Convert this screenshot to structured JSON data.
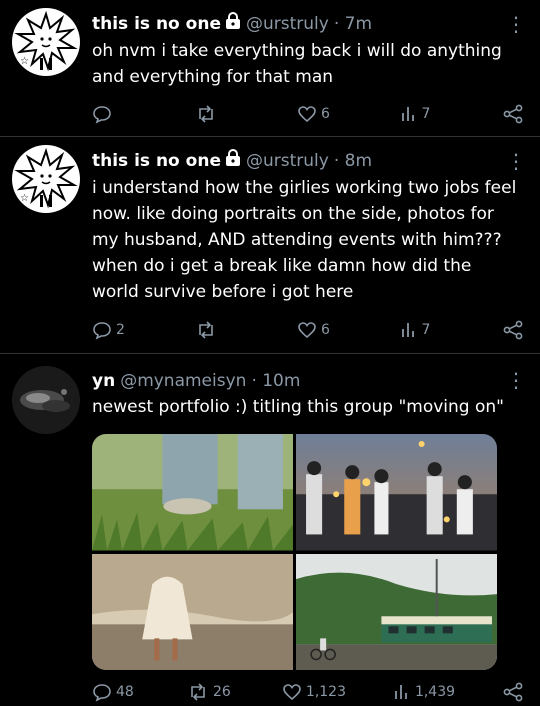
{
  "tweets": [
    {
      "name": "this is no one",
      "handle": "@urstruly",
      "time": "· 7m",
      "text": "oh nvm i take everything back i will do anything and everything for that man",
      "reply_count": "",
      "retweet_count": "",
      "like_count": "6",
      "view_count": "7"
    },
    {
      "name": "this is no one",
      "handle": "@urstruly",
      "time": "· 8m",
      "text": "i understand how the girlies working two jobs feel now. like doing portraits on the side, photos for my husband, AND attending events with him??? when do i get a break like damn how did the world survive before i got here",
      "reply_count": "2",
      "retweet_count": "",
      "like_count": "6",
      "view_count": "7"
    },
    {
      "name": "yn",
      "handle": "@mynameisyn",
      "time": "· 10m",
      "text": "newest portfolio :) titling this group \"moving on\"",
      "reply_count": "48",
      "retweet_count": "26",
      "like_count": "1,123",
      "view_count": "1,439"
    }
  ],
  "media": [
    "grass-with-legs-photo",
    "sparklers-at-dusk-photo",
    "walking-on-beach-photo",
    "green-train-photo"
  ],
  "icons": {
    "reply": "reply-icon",
    "retweet": "retweet-icon",
    "like": "heart-icon",
    "views": "views-icon",
    "share": "share-icon",
    "lock": "lock-icon",
    "more": "more-icon"
  },
  "colors": {
    "background": "#000000",
    "text": "#e7e9ea",
    "muted": "#8b98a5",
    "divider": "#2f3336"
  }
}
